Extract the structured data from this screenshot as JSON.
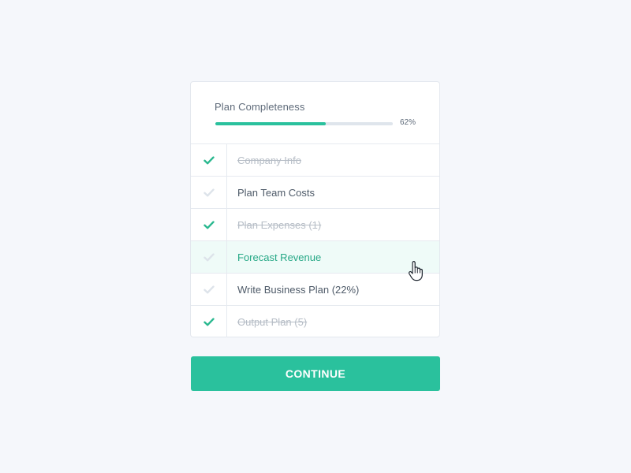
{
  "header": {
    "title": "Plan Completeness",
    "progress_percent": 62,
    "progress_label": "62%"
  },
  "items": [
    {
      "label": "Company Info",
      "done": true,
      "hovered": false,
      "icon": "check-icon"
    },
    {
      "label": "Plan Team Costs",
      "done": false,
      "hovered": false,
      "icon": "check-icon"
    },
    {
      "label": "Plan Expenses (1)",
      "done": true,
      "hovered": false,
      "icon": "check-icon"
    },
    {
      "label": "Forecast Revenue",
      "done": false,
      "hovered": true,
      "icon": "check-icon"
    },
    {
      "label": "Write Business Plan (22%)",
      "done": false,
      "hovered": false,
      "icon": "check-icon"
    },
    {
      "label": "Output Plan (5)",
      "done": true,
      "hovered": false,
      "icon": "check-icon"
    }
  ],
  "continue_button": {
    "label": "CONTINUE"
  },
  "colors": {
    "accent": "#2ac19d",
    "check_done": "#2ab88f",
    "check_pending": "#dde3ea",
    "hover_bg": "#effbf8",
    "hover_text": "#26a886",
    "background": "#f5f7fb"
  }
}
